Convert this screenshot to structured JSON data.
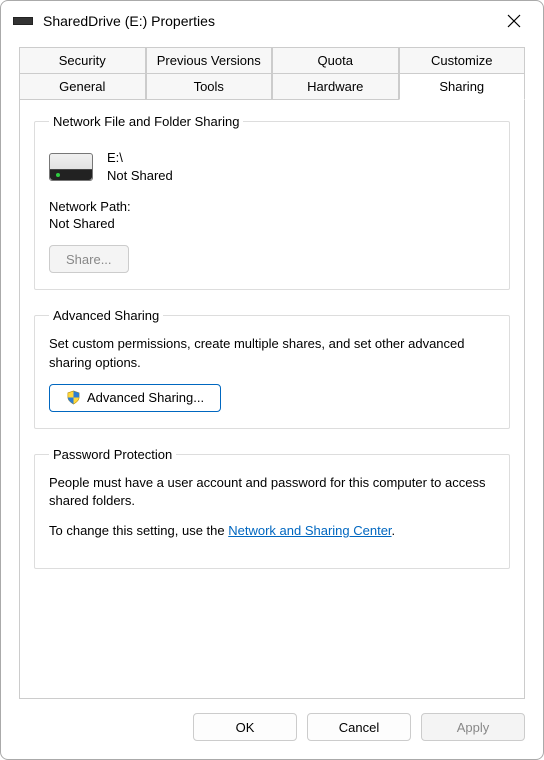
{
  "window": {
    "title": "SharedDrive (E:) Properties"
  },
  "tabs": {
    "row1": [
      "Security",
      "Previous Versions",
      "Quota",
      "Customize"
    ],
    "row2": [
      "General",
      "Tools",
      "Hardware",
      "Sharing"
    ],
    "active": "Sharing"
  },
  "section_nfs": {
    "legend": "Network File and Folder Sharing",
    "drive_label": "E:\\",
    "share_status": "Not Shared",
    "network_path_label": "Network Path:",
    "network_path_value": "Not Shared",
    "share_button": "Share..."
  },
  "section_adv": {
    "legend": "Advanced Sharing",
    "description": "Set custom permissions, create multiple shares, and set other advanced sharing options.",
    "button": "Advanced Sharing..."
  },
  "section_pwd": {
    "legend": "Password Protection",
    "line1": "People must have a user account and password for this computer to access shared folders.",
    "line2_prefix": "To change this setting, use the ",
    "link_text": "Network and Sharing Center",
    "line2_suffix": "."
  },
  "footer": {
    "ok": "OK",
    "cancel": "Cancel",
    "apply": "Apply"
  }
}
